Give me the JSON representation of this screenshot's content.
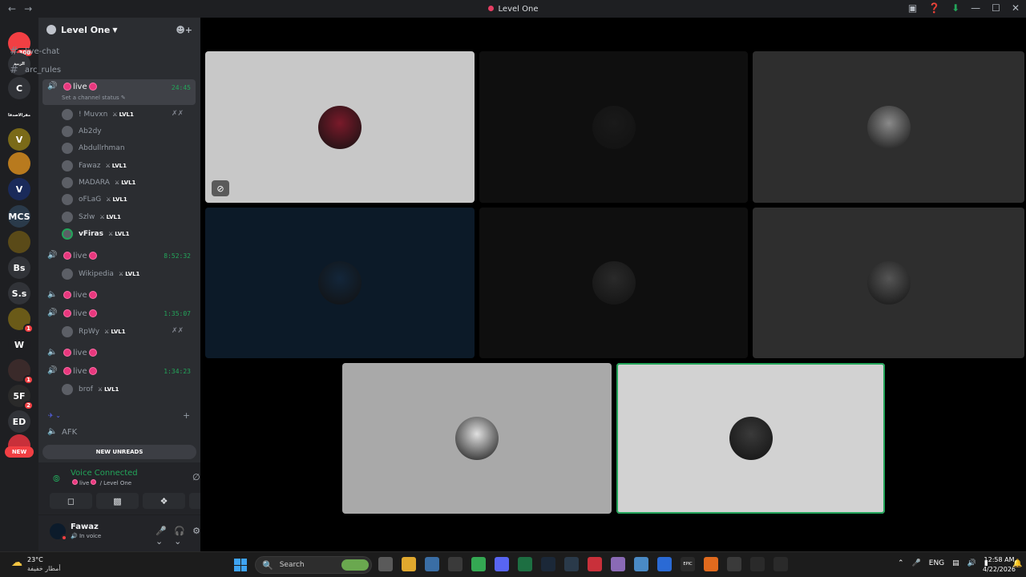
{
  "window": {
    "title": "Level One"
  },
  "servers": [
    {
      "label": "",
      "badge": "300",
      "color": "#f23f43"
    },
    {
      "label": "الزيبة",
      "badge": "",
      "color": "#313338"
    },
    {
      "label": "C",
      "badge": "",
      "color": "#313338"
    },
    {
      "label": "مقرالاصدقا",
      "badge": "",
      "color": "#1e1f22"
    },
    {
      "label": "V",
      "badge": "",
      "color": "#7a6a18"
    },
    {
      "label": "",
      "badge": "",
      "color": "#b87a1e"
    },
    {
      "label": "V",
      "badge": "",
      "color": "#1a2a5a"
    },
    {
      "label": "MCS",
      "badge": "",
      "color": "#2a3a4a"
    },
    {
      "label": "",
      "badge": "",
      "color": "#5a4a18"
    },
    {
      "label": "Bs",
      "badge": "",
      "color": "#313338"
    },
    {
      "label": "S.s",
      "badge": "",
      "color": "#313338"
    },
    {
      "label": "",
      "badge": "1",
      "color": "#6a5a18"
    },
    {
      "label": "W",
      "badge": "",
      "color": "#1e1f22"
    },
    {
      "label": "",
      "badge": "1",
      "color": "#3a2a2a"
    },
    {
      "label": "5F",
      "badge": "2",
      "color": "#2a2a2a"
    },
    {
      "label": "ED",
      "badge": "",
      "color": "#313338"
    },
    {
      "label": "",
      "badge": "",
      "color": "#c9303a"
    }
  ],
  "new_pill": "NEW",
  "guild": {
    "name": "Level One"
  },
  "text_channels": [
    {
      "name": "live-chat"
    },
    {
      "name": "arc_rules"
    }
  ],
  "voice": {
    "active": {
      "name": "live",
      "timer": "24:45",
      "status": "Set a channel status"
    },
    "users_active": [
      {
        "name": "! Muvxn",
        "lvl": "LVL1"
      },
      {
        "name": "Ab2dy",
        "lvl": ""
      },
      {
        "name": "Abdullrhman",
        "lvl": ""
      },
      {
        "name": "Fawaz",
        "lvl": "LVL1"
      },
      {
        "name": "MADARA",
        "lvl": "LVL1"
      },
      {
        "name": "oFLaG",
        "lvl": "LVL1"
      },
      {
        "name": "Szlw",
        "lvl": "LVL1"
      },
      {
        "name": "vFiras",
        "lvl": "LVL1"
      }
    ],
    "ch2": {
      "name": "live",
      "timer": "8:52:32"
    },
    "ch2_user": {
      "name": "Wikipedia",
      "lvl": "LVL1"
    },
    "ch3": {
      "name": "live"
    },
    "ch4": {
      "name": "live",
      "timer": "1:35:07"
    },
    "ch4_user": {
      "name": "RpWy",
      "lvl": "LVL1"
    },
    "ch5": {
      "name": "live"
    },
    "ch6": {
      "name": "live",
      "timer": "1:34:23"
    },
    "ch6_user": {
      "name": "brof",
      "lvl": "LVL1"
    },
    "afk": {
      "name": "AFK"
    }
  },
  "new_unreads": "NEW UNREADS",
  "voice_panel": {
    "title": "Voice Connected",
    "channel": "live",
    "server": "/ Level One"
  },
  "user_panel": {
    "name": "Fawaz",
    "status": "In voice"
  },
  "tiles": [
    {
      "bg": "#c8c8c8",
      "avatar": "#7a1a2a",
      "speaking": false,
      "muted": true
    },
    {
      "bg": "#0f0f0f",
      "avatar": "#1a1a1a",
      "speaking": false,
      "muted": false
    },
    {
      "bg": "#2e2e2e",
      "avatar": "#8a8a8a",
      "speaking": false,
      "muted": false
    },
    {
      "bg": "#0c1a28",
      "avatar": "#13263a",
      "speaking": false,
      "muted": false
    },
    {
      "bg": "#0f0f0f",
      "avatar": "#2a2a2a",
      "speaking": false,
      "muted": false
    },
    {
      "bg": "#2e2e2e",
      "avatar": "#555555",
      "speaking": false,
      "muted": false
    },
    {
      "bg": "#a9a9a9",
      "avatar": "#e0e0e0",
      "speaking": false,
      "muted": false
    },
    {
      "bg": "#d2d2d2",
      "avatar": "#3a3a3a",
      "speaking": true,
      "muted": false
    }
  ],
  "taskbar": {
    "weather_temp": "23°C",
    "weather_cond": "أمطار خفيفة",
    "search_placeholder": "Search",
    "apps": [
      {
        "label": "",
        "color": "#5a5a5a"
      },
      {
        "label": "",
        "color": "#e0a82e"
      },
      {
        "label": "",
        "color": "#3a6ea5"
      },
      {
        "label": "",
        "color": "#3a3a3a"
      },
      {
        "label": "",
        "color": "#34a853"
      },
      {
        "label": "",
        "color": "#5865f2"
      },
      {
        "label": "",
        "color": "#1d6f42"
      },
      {
        "label": "",
        "color": "#1b2838"
      },
      {
        "label": "",
        "color": "#2a3a4a"
      },
      {
        "label": "",
        "color": "#c9303a"
      },
      {
        "label": "",
        "color": "#8a6ab5"
      },
      {
        "label": "",
        "color": "#4a8ac5"
      },
      {
        "label": "",
        "color": "#2a6ad5"
      },
      {
        "label": "EPIC",
        "color": "#2a2a2a"
      },
      {
        "label": "",
        "color": "#e06a1e"
      },
      {
        "label": "",
        "color": "#3a3a3a"
      },
      {
        "label": "",
        "color": "#2a2a2a"
      },
      {
        "label": "",
        "color": "#2a2a2a"
      }
    ],
    "lang": "ENG",
    "time": "12:58 AM",
    "date": "4/22/2026"
  }
}
